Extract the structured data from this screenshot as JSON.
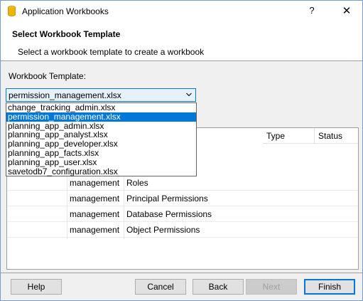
{
  "window": {
    "title": "Application Workbooks",
    "help_glyph": "?",
    "close_glyph": "✕"
  },
  "header": {
    "title": "Select Workbook Template",
    "subtitle": "Select a workbook template to create a workbook"
  },
  "template": {
    "label": "Workbook Template:",
    "selected": "permission_management.xlsx",
    "options": [
      "change_tracking_admin.xlsx",
      "permission_management.xlsx",
      "planning_app_admin.xlsx",
      "planning_app_analyst.xlsx",
      "planning_app_developer.xlsx",
      "planning_app_facts.xlsx",
      "planning_app_user.xlsx",
      "savetodb7_configuration.xlsx"
    ],
    "highlighted_index": 1
  },
  "table": {
    "columns": {
      "type": "Type",
      "status": "Status"
    },
    "rows": [
      {
        "schema": "management",
        "name": "Roles"
      },
      {
        "schema": "management",
        "name": "Principal Permissions"
      },
      {
        "schema": "management",
        "name": "Database Permissions"
      },
      {
        "schema": "management",
        "name": "Object Permissions"
      }
    ]
  },
  "buttons": {
    "help": "Help",
    "cancel": "Cancel",
    "back": "Back",
    "next": "Next",
    "finish": "Finish"
  },
  "colors": {
    "accent": "#0078d7",
    "selection": "#0078d7"
  }
}
